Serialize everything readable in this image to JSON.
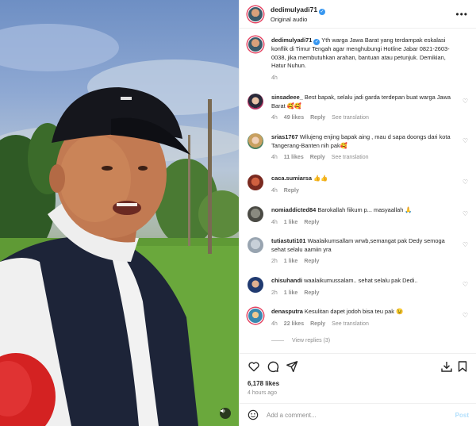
{
  "header": {
    "username": "dedimulyadi71",
    "subtitle": "Original audio",
    "more_icon": "ellipsis-icon"
  },
  "caption": {
    "username": "dedimulyadi71",
    "text": "Yth warga Jawa Barat yang terdampak eskalasi konflik di Timur Tengah agar menghubungi Hotline Jabar 0821-2603-0038, jika membutuhkan arahan, bantuan atau petunjuk. Demikian, Hatur Nuhun.",
    "time": "4h"
  },
  "comments": [
    {
      "username": "sinsadeee_",
      "text": "Best bapak, selalu jadi garda terdepan buat warga Jawa Barat 🥰🥰",
      "time": "4h",
      "likes": "49 likes",
      "reply": "Reply",
      "translation": "See translation"
    },
    {
      "username": "srias1767",
      "text": "Wilujeng enjing bapak aing , mau d sapa doongs dari kota Tangerang-Banten nih pak🥰",
      "time": "4h",
      "likes": "11 likes",
      "reply": "Reply",
      "translation": "See translation"
    },
    {
      "username": "caca.sumiarsa",
      "text": "👍👍",
      "time": "4h",
      "likes": "",
      "reply": "Reply",
      "translation": ""
    },
    {
      "username": "nomiaddicted84",
      "text": "Barokallah fiikum p... masyaallah 🙏",
      "time": "4h",
      "likes": "1 like",
      "reply": "Reply",
      "translation": ""
    },
    {
      "username": "tutiastuti101",
      "text": "Waalaikumsallam wrwb,semangat pak Dedy semoga sehat selalu aamiin yra",
      "time": "2h",
      "likes": "1 like",
      "reply": "Reply",
      "translation": ""
    },
    {
      "username": "chisuhandi",
      "text": "waalaikumussalam.. sehat selalu pak Dedi..",
      "time": "2h",
      "likes": "1 like",
      "reply": "Reply",
      "translation": ""
    },
    {
      "username": "denasputra",
      "text": "Kesulitan dapet jodoh bisa teu pak 😉",
      "time": "4h",
      "likes": "22 likes",
      "reply": "Reply",
      "translation": "See translation"
    }
  ],
  "view_replies": "View replies (3)",
  "footer": {
    "likes": "6,178 likes",
    "time": "4 hours ago",
    "comment_placeholder": "Add a comment...",
    "post_label": "Post"
  },
  "colors": {
    "verified": "#3897f0",
    "story_ring": "#e4405f",
    "muted_text": "#8e8e8e",
    "post_button": "#b2dffc"
  },
  "icons": [
    "heart-icon",
    "comment-icon",
    "share-icon",
    "download-icon",
    "bookmark-icon",
    "emoji-icon",
    "volume-icon"
  ]
}
